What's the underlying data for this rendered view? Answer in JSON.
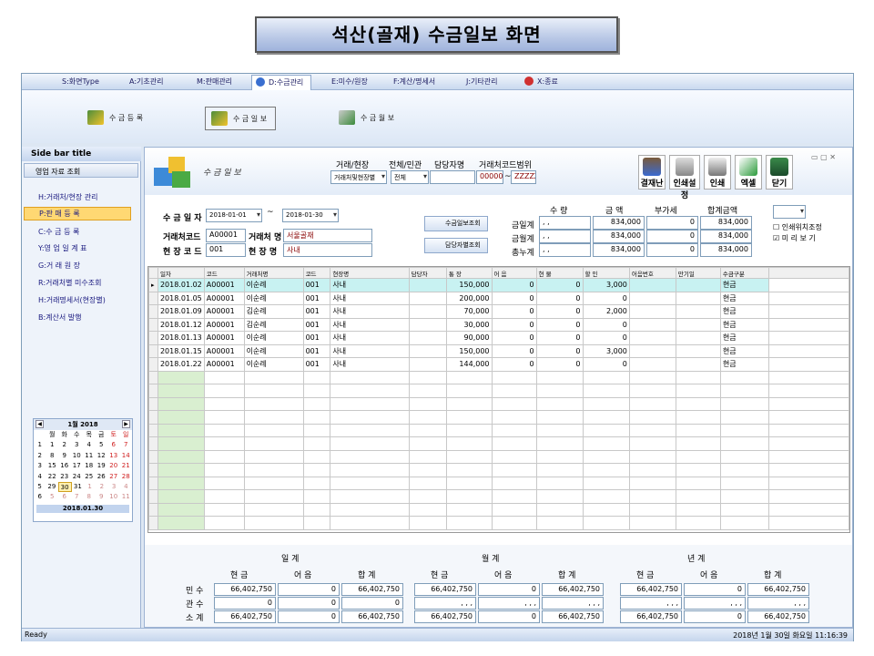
{
  "banner": {
    "title": "석산(골재) 수금일보 화면"
  },
  "menu": [
    {
      "label": "S:화면Type"
    },
    {
      "label": "A:기초관리"
    },
    {
      "label": "M:판매관리"
    },
    {
      "label": "D:수금관리"
    },
    {
      "label": "E:미수/원장"
    },
    {
      "label": "F:계산/명세서"
    },
    {
      "label": "J:기타관리"
    },
    {
      "label": "X:종료"
    }
  ],
  "ribbon": [
    {
      "label": "수 금 등 록"
    },
    {
      "label": "수 금 일 보"
    },
    {
      "label": "수 금 월 보"
    }
  ],
  "sidebar": {
    "title": "Side bar title",
    "section": "영업 자료 조회",
    "items": [
      {
        "label": "H:거래처/현장 관리"
      },
      {
        "label": "P:판 매 등 록"
      },
      {
        "label": "C:수 금 등 록"
      },
      {
        "label": "Y:영 업 일 계 표"
      },
      {
        "label": "G:거 래 원 장"
      },
      {
        "label": "R:거래처별 미수조회"
      },
      {
        "label": "H:거래명세서(현장별)"
      },
      {
        "label": "B:계산서 발행"
      }
    ]
  },
  "calendar": {
    "month": "1월 2018",
    "weekdays": [
      "월",
      "화",
      "수",
      "목",
      "금",
      "토",
      "일"
    ],
    "weeks": [
      [
        "1",
        "1",
        "2",
        "3",
        "4",
        "5",
        "6",
        "7"
      ],
      [
        "2",
        "8",
        "9",
        "10",
        "11",
        "12",
        "13",
        "14"
      ],
      [
        "3",
        "15",
        "16",
        "17",
        "18",
        "19",
        "20",
        "21"
      ],
      [
        "4",
        "22",
        "23",
        "24",
        "25",
        "26",
        "27",
        "28"
      ],
      [
        "5",
        "29",
        "30",
        "31",
        "1",
        "2",
        "3",
        "4"
      ],
      [
        "6",
        "5",
        "6",
        "7",
        "8",
        "9",
        "10",
        "11"
      ]
    ],
    "footer": "2018.01.30"
  },
  "header": {
    "title": "수 금 일 보",
    "site_label": "거래/현장",
    "site_value": "거래처및현장별",
    "scope_label": "전체/민관",
    "scope_value": "전체",
    "manager_label": "담당자명",
    "manager_value": "",
    "code_range_label": "거래처코드범위",
    "code_from": "000000",
    "code_tilde": "~",
    "code_to": "ZZZZZ"
  },
  "toolbar": [
    {
      "label": "결재난"
    },
    {
      "label": "인쇄설정"
    },
    {
      "label": "인쇄"
    },
    {
      "label": "엑셀"
    },
    {
      "label": "닫기"
    }
  ],
  "filters": {
    "date_label": "수 금 일 자",
    "date_from": "2018-01-01",
    "tilde": "~",
    "date_to": "2018-01-30",
    "client_code_label": "거래처코드",
    "client_code": "A00001",
    "client_name_label": "거래처 명",
    "client_name": "서울골재",
    "site_code_label": "현 장 코 드",
    "site_code": "001",
    "site_name_label": "현 장 명",
    "site_name": "사내",
    "btn_report": "수금일보조회",
    "btn_manager": "담당자별조회"
  },
  "totals": {
    "headers": [
      "수   량",
      "금   액",
      "부가세",
      "합계금액"
    ],
    "rows": [
      {
        "label": "금일계",
        "qty": ", ,",
        "amount": "834,000",
        "vat": "0",
        "total": "834,000"
      },
      {
        "label": "금월계",
        "qty": ", ,",
        "amount": "834,000",
        "vat": "0",
        "total": "834,000"
      },
      {
        "label": "총누계",
        "qty": ", ,",
        "amount": "834,000",
        "vat": "0",
        "total": "834,000"
      }
    ]
  },
  "options": {
    "print_pos": "인쇄위치조정",
    "preview": "미 리  보 기"
  },
  "grid": {
    "columns": [
      "일자",
      "코드",
      "거래처명",
      "코드",
      "현장명",
      "담당자",
      "통 장",
      "어 음",
      "현 물",
      "할 인",
      "어음번호",
      "만기일",
      "수금구분"
    ],
    "rows": [
      [
        "2018.01.02",
        "A00001",
        "이순례",
        "001",
        "사내",
        "",
        "150,000",
        "0",
        "0",
        "3,000",
        "",
        "",
        "현금"
      ],
      [
        "2018.01.05",
        "A00001",
        "이순례",
        "001",
        "사내",
        "",
        "200,000",
        "0",
        "0",
        "0",
        "",
        "",
        "현금"
      ],
      [
        "2018.01.09",
        "A00001",
        "김순례",
        "001",
        "사내",
        "",
        "70,000",
        "0",
        "0",
        "2,000",
        "",
        "",
        "현금"
      ],
      [
        "2018.01.12",
        "A00001",
        "김순례",
        "001",
        "사내",
        "",
        "30,000",
        "0",
        "0",
        "0",
        "",
        "",
        "현금"
      ],
      [
        "2018.01.13",
        "A00001",
        "이순례",
        "001",
        "사내",
        "",
        "90,000",
        "0",
        "0",
        "0",
        "",
        "",
        "현금"
      ],
      [
        "2018.01.15",
        "A00001",
        "이순례",
        "001",
        "사내",
        "",
        "150,000",
        "0",
        "0",
        "3,000",
        "",
        "",
        "현금"
      ],
      [
        "2018.01.22",
        "A00001",
        "이순례",
        "001",
        "사내",
        "",
        "144,000",
        "0",
        "0",
        "0",
        "",
        "",
        "현금"
      ]
    ]
  },
  "summary": {
    "groups": [
      "일  계",
      "월  계",
      "년  계"
    ],
    "sub": [
      "현  금",
      "어  음",
      "합  계"
    ],
    "rowlabels": [
      "민  수",
      "관  수",
      "소  계"
    ],
    "day": [
      [
        "66,402,750",
        "0",
        "66,402,750"
      ],
      [
        "0",
        "0",
        "0"
      ],
      [
        "66,402,750",
        "0",
        "66,402,750"
      ]
    ],
    "month": [
      [
        "66,402,750",
        "0",
        "66,402,750"
      ],
      [
        ", , ,",
        ", , ,",
        ", , ,"
      ],
      [
        "66,402,750",
        "0",
        "66,402,750"
      ]
    ],
    "year": [
      [
        "66,402,750",
        "0",
        "66,402,750"
      ],
      [
        ", , ,",
        ", , ,",
        ", , ,"
      ],
      [
        "66,402,750",
        "0",
        "66,402,750"
      ]
    ]
  },
  "status": {
    "left": "Ready",
    "right": "2018년 1월 30일 화요일 11:16:39"
  }
}
